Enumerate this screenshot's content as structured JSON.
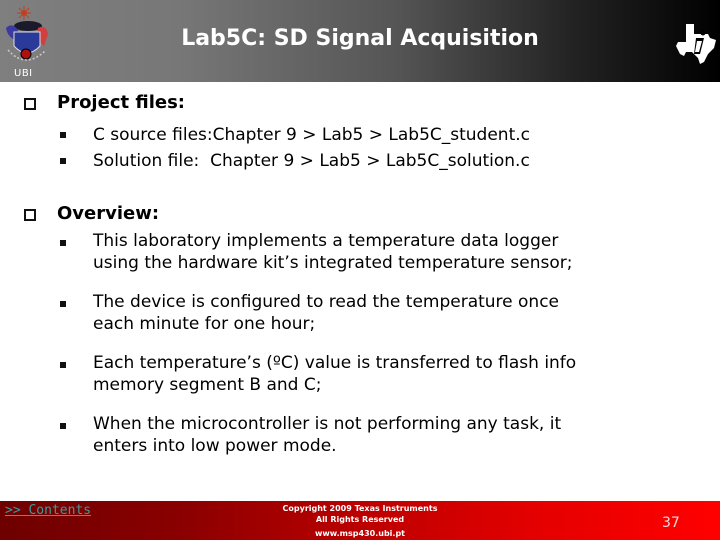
{
  "header": {
    "title": "Lab5C: SD Signal Acquisition",
    "left_logo_label": "UBI",
    "right_logo": "texas-instruments-logo",
    "colors": {
      "gradient_start": "#7f7f7f",
      "gradient_end": "#000000"
    }
  },
  "sections": [
    {
      "heading": "Project files:",
      "icon": "checkbox-icon",
      "bullets": [
        {
          "lines": [
            "C source files:Chapter 9 > Lab5 > Lab5C_student.c"
          ]
        },
        {
          "lines": [
            "Solution file:  Chapter 9 > Lab5 > Lab5C_solution.c"
          ]
        }
      ]
    },
    {
      "heading": "Overview:",
      "icon": "checkbox-icon",
      "bullets": [
        {
          "lines": [
            "This laboratory implements a temperature data logger",
            "using the hardware kit’s integrated temperature sensor;"
          ]
        },
        {
          "lines": [
            "The device is configured to read the temperature once",
            "each minute for one hour;"
          ]
        },
        {
          "lines": [
            "Each temperature’s (ºC) value is transferred to flash info",
            "memory segment B and C;"
          ]
        },
        {
          "lines": [
            "When the microcontroller is not performing any task, it",
            "enters into low power mode."
          ]
        }
      ]
    }
  ],
  "footer": {
    "contents_link": ">> Contents",
    "copyright_line1": "Copyright  2009 Texas Instruments",
    "copyright_line2": "All Rights Reserved",
    "url": "www.msp430.ubi.pt",
    "page_number": "37",
    "colors": {
      "gradient_start": "#6e0000",
      "gradient_end": "#ff0000",
      "link": "#3f9b9b"
    }
  }
}
